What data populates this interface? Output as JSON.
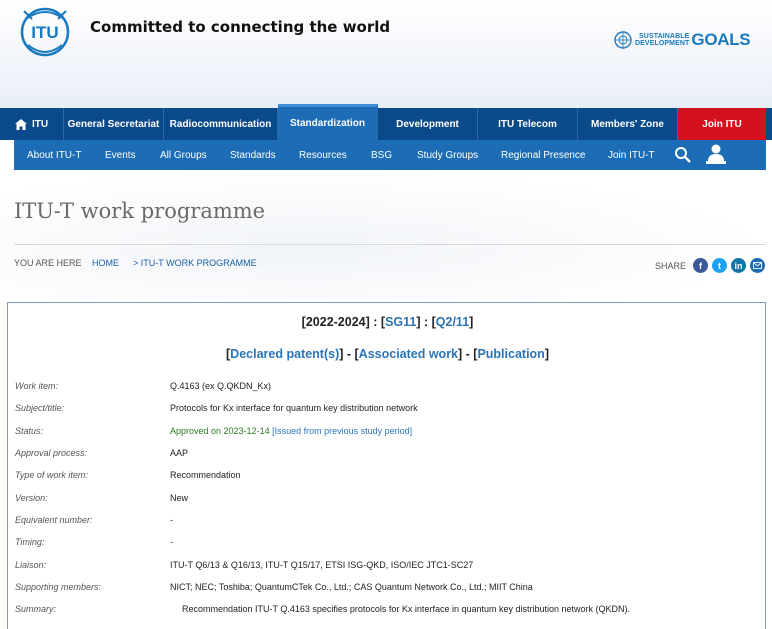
{
  "header": {
    "tagline": "Committed to connecting the world",
    "logo_text": "ITU",
    "sdg": {
      "line1": "SUSTAINABLE",
      "line2": "DEVELOPMENT",
      "goals": "GOALS"
    }
  },
  "nav_primary": [
    {
      "label": "ITU"
    },
    {
      "label": "General Secretariat"
    },
    {
      "label": "Radiocommunication"
    },
    {
      "label": "Standardization"
    },
    {
      "label": "Development"
    },
    {
      "label": "ITU Telecom"
    },
    {
      "label": "Members' Zone"
    },
    {
      "label": "Join ITU"
    }
  ],
  "nav_secondary": [
    {
      "label": "About ITU-T"
    },
    {
      "label": "Events"
    },
    {
      "label": "All Groups"
    },
    {
      "label": "Standards"
    },
    {
      "label": "Resources"
    },
    {
      "label": "BSG"
    },
    {
      "label": "Study Groups"
    },
    {
      "label": "Regional Presence"
    },
    {
      "label": "Join ITU-T"
    }
  ],
  "page": {
    "title": "ITU-T work programme",
    "breadcrumb": {
      "you_are_here": "YOU ARE HERE",
      "home": "HOME",
      "current": "> ITU-T WORK PROGRAMME"
    },
    "share_label": "SHARE"
  },
  "panel": {
    "period": "[2022-2024]",
    "sep1": " : [",
    "sg": "SG11",
    "sep2": "] : [",
    "question": "Q2/11",
    "sep3": "]",
    "links": {
      "lb1": "[",
      "declared": "Declared patent(s)",
      "mid1": "]  - [",
      "associated": "Associated work",
      "mid2": "]  - [",
      "publication": "Publication",
      "rb": "]"
    },
    "rows": [
      {
        "label": "Work item:",
        "value": "Q.4163 (ex Q.QKDN_Kx)"
      },
      {
        "label": "Subject/title:",
        "value": "Protocols for Kx interface for quantum key distribution network"
      },
      {
        "label": "Status:",
        "value": "Approved on 2023-12-14",
        "extra": " [Issued from previous study period]"
      },
      {
        "label": "Approval process:",
        "value": "AAP"
      },
      {
        "label": "Type of work item:",
        "value": "Recommendation"
      },
      {
        "label": "Version:",
        "value": "New"
      },
      {
        "label": "Equivalent number:",
        "value": "-"
      },
      {
        "label": "Timing:",
        "value": "-"
      },
      {
        "label": "Liaison:",
        "value": "ITU-T Q6/13 & Q16/13, ITU-T Q15/17, ETSI ISG-QKD, ISO/IEC JTC1-SC27"
      },
      {
        "label": "Supporting members:",
        "value": "NICT; NEC; Toshiba; QuantumCTek Co., Ltd.; CAS Quantum Network Co., Ltd.; MIIT China"
      },
      {
        "label": "Summary:",
        "value": "Recommendation ITU-T Q.4163 specifies protocols for Kx interface in quantum key distribution network (QKDN)."
      }
    ]
  },
  "colors": {
    "nav_dark": "#0a4a8a",
    "nav_light": "#1c6db5",
    "join_red": "#d4121e",
    "link": "#2a74b8",
    "green": "#2a7a20"
  }
}
